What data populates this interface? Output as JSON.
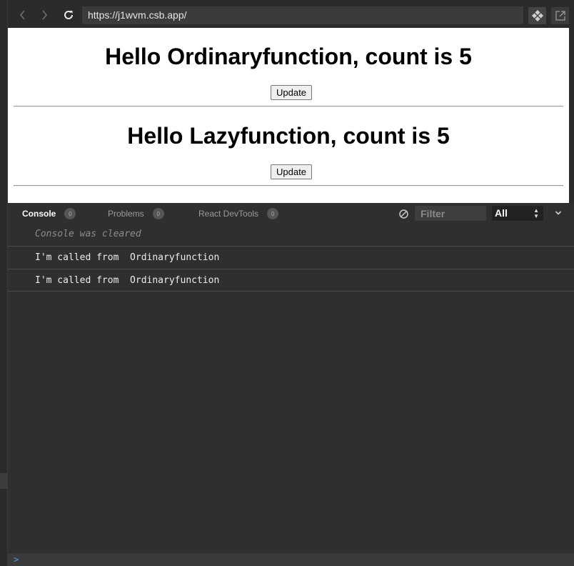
{
  "toolbar": {
    "url": "https://j1wvm.csb.app/",
    "icons": {
      "back": "chevron-left-icon",
      "forward": "chevron-right-icon",
      "reload": "reload-icon",
      "codesandbox": "codesandbox-icon",
      "open_new": "open-in-new-window-icon"
    }
  },
  "preview": {
    "heading_1": "Hello Ordinaryfunction, count is 5",
    "button_1": "Update",
    "heading_2": "Hello Lazyfunction, count is 5",
    "button_2": "Update"
  },
  "console": {
    "tabs": [
      {
        "label": "Console",
        "count": "0",
        "active": true
      },
      {
        "label": "Problems",
        "count": "0",
        "active": false
      },
      {
        "label": "React DevTools",
        "count": "0",
        "active": false
      }
    ],
    "filter_placeholder": "Filter",
    "level_selected": "All",
    "cleared_message": "Console was cleared",
    "logs": [
      "I'm called from  Ordinaryfunction",
      "I'm called from  Ordinaryfunction"
    ],
    "prompt_symbol": ">"
  },
  "colors": {
    "panel_bg": "#2f2f2f",
    "toolbar_bg": "#2b2b2b",
    "url_bar_bg": "#3b3b3b",
    "prompt_accent": "#4fa0e6"
  }
}
